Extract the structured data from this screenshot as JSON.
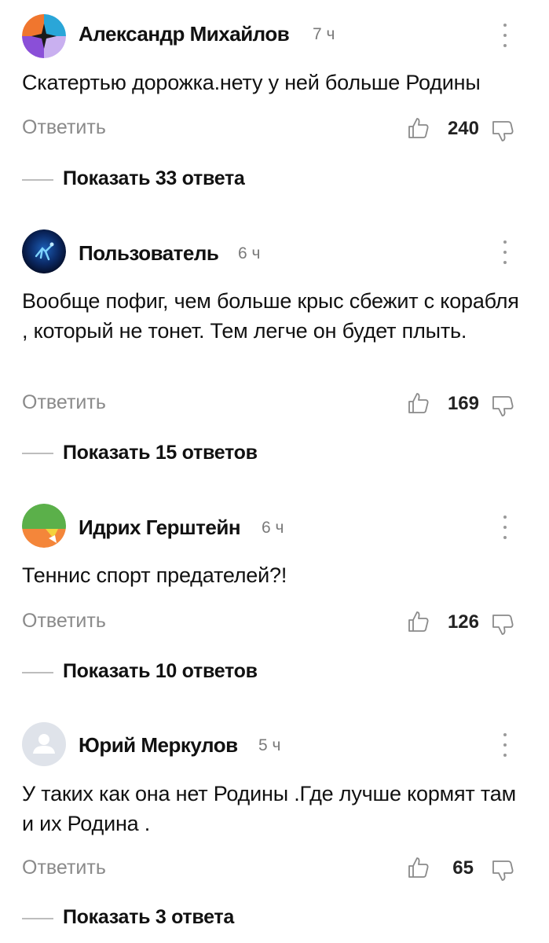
{
  "comments": [
    {
      "author": "Александр Михайлов",
      "time": "7 ч",
      "text": "Скатертью дорожка.нету у ней больше Родины",
      "reply_label": "Ответить",
      "likes": "240",
      "show_replies": "Показать 33 ответа",
      "avatar": "colored-quadrant-logo"
    },
    {
      "author": "Пользователь",
      "time": "6 ч",
      "text": "Вообще пофиг, чем больше крыс сбежит с корабля , который не тонет. Тем легче он будет плыть.",
      "reply_label": "Ответить",
      "likes": "169",
      "show_replies": "Показать 15 ответов",
      "avatar": "dark-blue-figure-avatar"
    },
    {
      "author": "Идрих Герштейн",
      "time": "6 ч",
      "text": "Теннис спорт предателей?!",
      "reply_label": "Ответить",
      "likes": "126",
      "show_replies": "Показать 10 ответов",
      "avatar": "green-orange-shapes-logo"
    },
    {
      "author": "Юрий Меркулов",
      "time": "5 ч",
      "text": "У таких как она нет Родины .Где лучше кормят там и их Родина .",
      "reply_label": "Ответить",
      "likes": "65",
      "show_replies": "Показать 3 ответа",
      "avatar": "default-user-avatar"
    }
  ],
  "colors": {
    "muted_text": "#8a8a8a",
    "divider": "#bdbdbd",
    "icon": "#8a8a8a"
  }
}
